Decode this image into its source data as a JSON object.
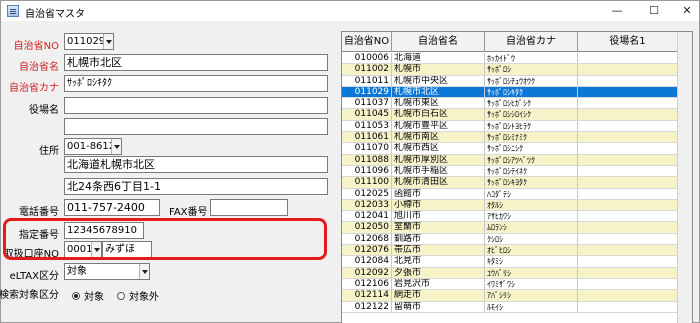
{
  "window": {
    "title": "自治省マスタ",
    "minimize": "—",
    "maximize": "☐",
    "close": "✕"
  },
  "form": {
    "code": {
      "label": "自治省NO",
      "value": "011029"
    },
    "name": {
      "label": "自治省名",
      "value": "札幌市北区"
    },
    "kana": {
      "label": "自治省カナ",
      "value": "ｻｯﾎﾟﾛｼｷﾀｸ"
    },
    "office": {
      "label": "役場名",
      "line1": "",
      "line2": ""
    },
    "address": {
      "label": "住所",
      "zip": "001-8612",
      "line1": "北海道札幌市北区",
      "line2": "北24条西6丁目1-1"
    },
    "phone": {
      "label": "電話番号",
      "value": "011-757-2400"
    },
    "fax": {
      "label": "FAX番号",
      "value": ""
    },
    "designated": {
      "label": "指定番号",
      "value": "12345678910"
    },
    "account": {
      "label": "取扱口座NO",
      "value": "0001",
      "bank": "みずほ"
    },
    "eltax": {
      "label": "eLTAX区分",
      "value": "対象"
    },
    "search": {
      "label": "検索対象区分",
      "option_on": "対象",
      "option_off": "対象外",
      "selected": "対象"
    }
  },
  "grid": {
    "columns": [
      "自治省NO",
      "自治省名",
      "自治省カナ",
      "役場名1"
    ],
    "selected_code": "011029",
    "rows": [
      [
        "010006",
        "北海道",
        "ﾎｯｶｲﾄﾞｳ",
        ""
      ],
      [
        "011002",
        "札幌市",
        "ｻｯﾎﾟﾛｼ",
        ""
      ],
      [
        "011011",
        "札幌市中央区",
        "ｻｯﾎﾟﾛｼﾁｭｳｵｳｸ",
        ""
      ],
      [
        "011029",
        "札幌市北区",
        "ｻｯﾎﾟﾛｼｷﾀｸ",
        ""
      ],
      [
        "011037",
        "札幌市東区",
        "ｻｯﾎﾟﾛｼﾋｶﾞｼｸ",
        ""
      ],
      [
        "011045",
        "札幌市白石区",
        "ｻｯﾎﾟﾛｼｼﾛｲｼｸ",
        ""
      ],
      [
        "011053",
        "札幌市豊平区",
        "ｻｯﾎﾟﾛｼﾄﾖﾋﾗｸ",
        ""
      ],
      [
        "011061",
        "札幌市南区",
        "ｻｯﾎﾟﾛｼﾐﾅﾐｸ",
        ""
      ],
      [
        "011070",
        "札幌市西区",
        "ｻｯﾎﾟﾛｼﾆｼｸ",
        ""
      ],
      [
        "011088",
        "札幌市厚別区",
        "ｻｯﾎﾟﾛｼｱﾂﾍﾞﾂｸ",
        ""
      ],
      [
        "011096",
        "札幌市手稲区",
        "ｻｯﾎﾟﾛｼﾃｲﾈｸ",
        ""
      ],
      [
        "011100",
        "札幌市清田区",
        "ｻｯﾎﾟﾛｼｷﾖﾀｸ",
        ""
      ],
      [
        "012025",
        "函館市",
        "ﾊｺﾀﾞﾃｼ",
        ""
      ],
      [
        "012033",
        "小樽市",
        "ｵﾀﾙｼ",
        ""
      ],
      [
        "012041",
        "旭川市",
        "ｱｻﾋｶﾜｼ",
        ""
      ],
      [
        "012050",
        "室蘭市",
        "ﾑﾛﾗﾝｼ",
        ""
      ],
      [
        "012068",
        "釧路市",
        "ｸｼﾛｼ",
        ""
      ],
      [
        "012076",
        "帯広市",
        "ｵﾋﾞﾋﾛｼ",
        ""
      ],
      [
        "012084",
        "北見市",
        "ｷﾀﾐｼ",
        ""
      ],
      [
        "012092",
        "夕張市",
        "ﾕｳﾊﾞﾘｼ",
        ""
      ],
      [
        "012106",
        "岩見沢市",
        "ｲﾜﾐｻﾞﾜｼ",
        ""
      ],
      [
        "012114",
        "網走市",
        "ｱﾊﾞｼﾘｼ",
        ""
      ],
      [
        "012122",
        "留萌市",
        "ﾙﾓｲｼ",
        ""
      ]
    ]
  },
  "colors": {
    "selection": "#0b78d7",
    "band": "#f6f3c8",
    "required_label": "#d02020",
    "highlight_box": "#e21b1b"
  }
}
